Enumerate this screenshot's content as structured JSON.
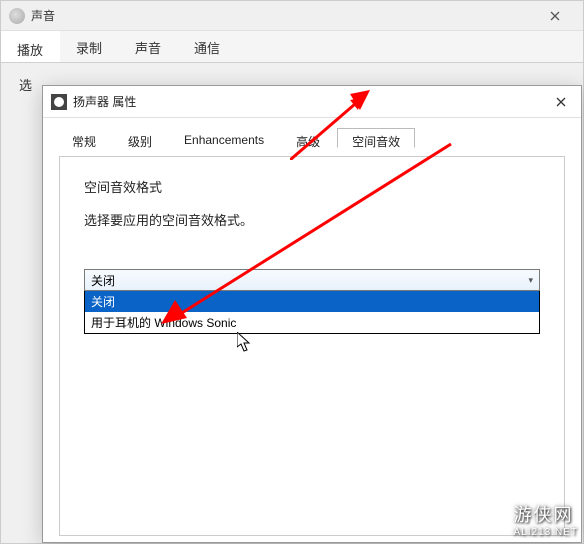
{
  "sound_window": {
    "title": "声音",
    "tabs": [
      "播放",
      "录制",
      "声音",
      "通信"
    ],
    "active_tab_index": 0,
    "body_label": "选"
  },
  "speaker_window": {
    "title": "扬声器 属性",
    "tabs": [
      "常规",
      "级别",
      "Enhancements",
      "高级",
      "空间音效"
    ],
    "active_tab_index": 4,
    "panel": {
      "section_title": "空间音效格式",
      "section_desc": "选择要应用的空间音效格式。",
      "combo_value": "关闭",
      "combo_options": [
        "关闭",
        "用于耳机的 Windows Sonic"
      ],
      "combo_highlight_index": 0
    }
  },
  "watermark": {
    "main": "游侠网",
    "sub": "ALI213.NET"
  },
  "colors": {
    "highlight": "#0a64c8",
    "arrow": "#ff0000"
  }
}
